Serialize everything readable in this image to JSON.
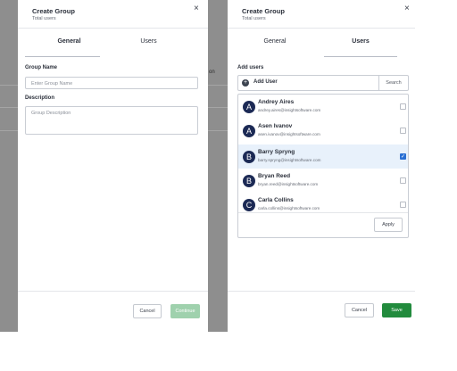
{
  "background": {
    "peek_text": "on"
  },
  "left_panel": {
    "title": "Create Group",
    "subtitle": "Total users",
    "close_glyph": "×",
    "tabs": [
      {
        "label": "General",
        "active": true
      },
      {
        "label": "Users",
        "active": false
      }
    ],
    "group_name": {
      "label": "Group Name",
      "placeholder": "Enter Group Name"
    },
    "description": {
      "label": "Description",
      "placeholder": "Group Description"
    },
    "cancel_label": "Cancel",
    "continue_label": "Continue"
  },
  "right_panel": {
    "title": "Create Group",
    "subtitle": "Total users",
    "close_glyph": "×",
    "tabs": [
      {
        "label": "General",
        "active": false
      },
      {
        "label": "Users",
        "active": true
      }
    ],
    "add_users_label": "Add users",
    "add_user_button": "Add User",
    "plus_glyph": "+",
    "search_label": "Search",
    "users": [
      {
        "initial": "A",
        "name": "Andrey Aires",
        "email": "andrey.aires@insightsoftware.com",
        "selected": false
      },
      {
        "initial": "A",
        "name": "Asen Ivanov",
        "email": "asen.ivanov@insightsoftware.com",
        "selected": false
      },
      {
        "initial": "B",
        "name": "Barry Spryng",
        "email": "barry.spryng@insightsoftware.com",
        "selected": true
      },
      {
        "initial": "B",
        "name": "Bryan Reed",
        "email": "bryan.reed@insightsoftware.com",
        "selected": false
      },
      {
        "initial": "C",
        "name": "Carla Collins",
        "email": "carla.collins@insightsoftware.com",
        "selected": false
      }
    ],
    "check_glyph": "✓",
    "apply_label": "Apply",
    "cancel_label": "Cancel",
    "save_label": "Save"
  },
  "colors": {
    "accent_green": "#228b3d",
    "checkbox_blue": "#2a6fd3",
    "avatar_navy": "#1c2a55",
    "overlay_gray": "#8e8e8e"
  }
}
